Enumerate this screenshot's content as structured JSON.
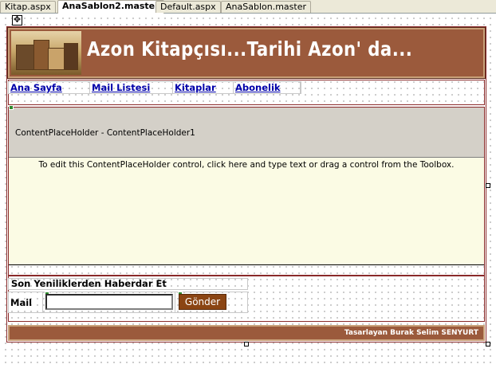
{
  "tabs": [
    {
      "label": "Kitap.aspx",
      "active": false
    },
    {
      "label": "AnaSablon2.master",
      "active": true
    },
    {
      "label": "Default.aspx",
      "active": false
    },
    {
      "label": "AnaSablon.master",
      "active": false
    }
  ],
  "header": {
    "title": "Azon Kitapçısı...Tarihi Azon' da..."
  },
  "nav": {
    "items": [
      {
        "label": "Ana Sayfa"
      },
      {
        "label": "Mail Listesi"
      },
      {
        "label": "Kitaplar"
      },
      {
        "label": "Abonelik"
      }
    ]
  },
  "content_placeholder": {
    "label": "ContentPlaceHolder - ContentPlaceHolder1",
    "hint": "To edit this ContentPlaceHolder control, click here and type text or drag a control from the Toolbox."
  },
  "newsletter": {
    "title": "Son Yeniliklerden Haberdar Et",
    "mail_label": "Mail",
    "mail_value": "",
    "send_label": "Gönder"
  },
  "footer": {
    "text": "Tasarlayan Burak Selim SENYURT"
  },
  "colors": {
    "brand_brown": "#9b5a3c",
    "link_blue": "#0000aa",
    "placeholder_bg": "#fbfbe4"
  }
}
